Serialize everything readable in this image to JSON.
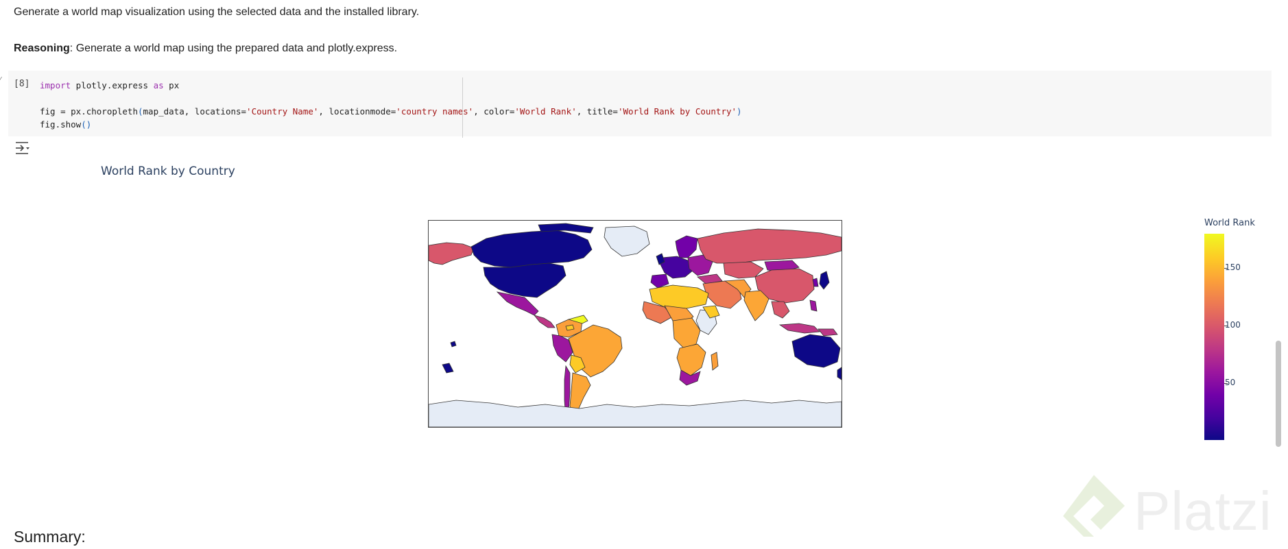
{
  "markdown": {
    "intro": "Generate a world map visualization using the selected data and the installed library.",
    "reasoning_label": "Reasoning",
    "reasoning_text": ": Generate a world map using the prepared data and plotly.express."
  },
  "code_cell": {
    "execution_count": "[8]",
    "line1_kw1": "import",
    "line1_mid": " plotly.express ",
    "line1_kw2": "as",
    "line1_end": " px",
    "line3_a": "fig = px.choropleth",
    "line3_p1": "(",
    "line3_b": "map_data, locations=",
    "line3_s1": "'Country Name'",
    "line3_c": ", locationmode=",
    "line3_s2": "'country names'",
    "line3_d": ", color=",
    "line3_s3": "'World Rank'",
    "line3_e": ", title=",
    "line3_s4": "'World Rank by Country'",
    "line3_p2": ")",
    "line4_a": "fig.show",
    "line4_p": "()"
  },
  "plot": {
    "title": "World Rank by Country",
    "colorbar_title": "World Rank",
    "colorbar_ticks": [
      "150",
      "100",
      "50"
    ],
    "colorscale": [
      "#0d0887",
      "#46039f",
      "#7201a8",
      "#9c179e",
      "#bd3786",
      "#d8576b",
      "#ed7953",
      "#fb9f3a",
      "#fdca26",
      "#f0f921"
    ],
    "land_no_data_color": "#e5ecf6"
  },
  "summary_heading": "Summary:",
  "watermark": "Platzi",
  "icons": {
    "output": "output-toggle-icon",
    "watermark_logo": "platzi-logo-icon"
  }
}
